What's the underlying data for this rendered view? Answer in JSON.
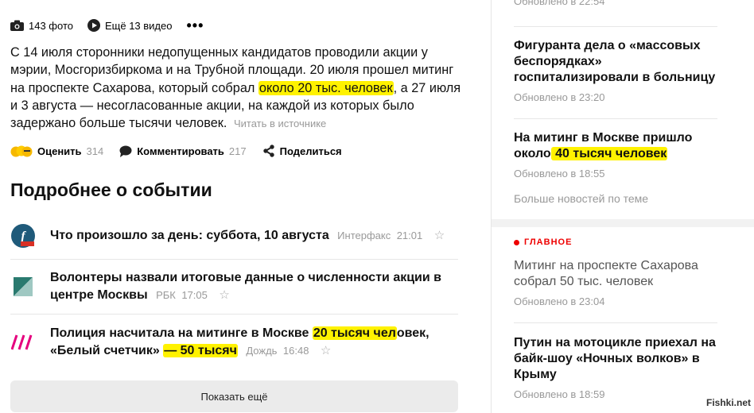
{
  "media_bar": {
    "photos_label": "143 фото",
    "videos_label": "Ещё 13 видео",
    "more_label": "•••"
  },
  "article": {
    "text_1": "С 14 июля сторонники недопущенных кандидатов проводили акции у мэрии, Мосгоризбиркома и на Трубной площади. 20 июля прошел митинг на проспекте Сахарова, который собрал",
    "highlight": "около 20 тыс. человек",
    "text_2": ", а 27 июля и 3 августа — несогласованные акции, на каждой из которых было задержано больше тысячи человек.",
    "source_link": "Читать в источнике"
  },
  "actions": {
    "rate_label": "Оценить",
    "rate_count": "314",
    "comment_label": "Комментировать",
    "comment_count": "217",
    "share_label": "Поделиться"
  },
  "section_title": "Подробнее о событии",
  "related": [
    {
      "title": "Что произошло за день: суббота, 10 августа",
      "source": "Интерфакс",
      "time": "21:01"
    },
    {
      "title": "Волонтеры назвали итоговые данные о численности акции в центре Москвы",
      "source": "РБК",
      "time": "17:05"
    },
    {
      "title_1": "Полиция насчитала на митинге в Москве ",
      "title_hl_1": "20 тысяч чел",
      "title_2": "овек, «Белый счетчик» ",
      "title_hl_2": "— 50 тысяч",
      "source": "Дождь",
      "time": "16:48"
    }
  ],
  "show_more_label": "Показать ещё",
  "sidebar": {
    "top_time": "Обновлено в 22:54",
    "news": [
      {
        "title": "Фигуранта дела о «массовых беспорядках» госпитализировали в больницу",
        "time": "Обновлено в 23:20"
      },
      {
        "title_1": "На митинг в Москве пришло около",
        "title_hl": " 40 тысяч человек",
        "time": "Обновлено в 18:55"
      }
    ],
    "more_topic": "Больше новостей по теме",
    "main_label": "ГЛАВНОЕ",
    "main_news": [
      {
        "title": "Митинг на проспекте Сахарова собрал 50 тыс. человек",
        "time": "Обновлено в 23:04"
      },
      {
        "title": "Путин на мотоцикле приехал на байк-шоу «Ночных волков» в Крыму",
        "time": "Обновлено в 18:59"
      }
    ]
  },
  "watermark": "Fishki.net",
  "colors": {
    "highlight": "#fff200",
    "accent_red": "#ee0000",
    "muted": "#999999"
  }
}
